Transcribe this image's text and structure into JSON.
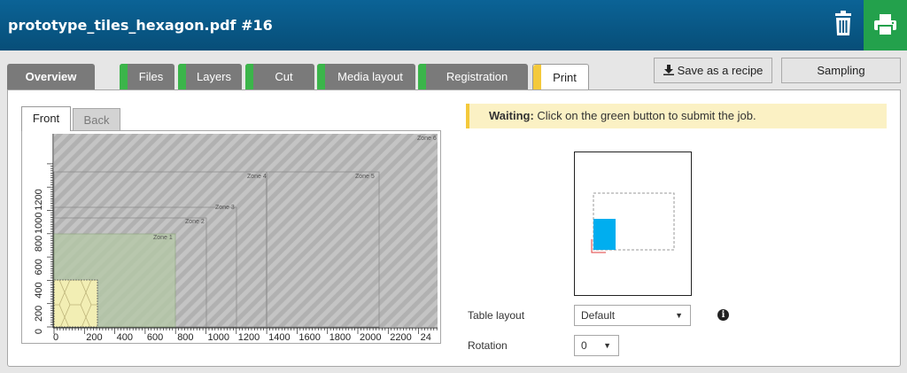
{
  "header": {
    "title": "prototype_tiles_hexagon.pdf #16"
  },
  "icons": {
    "delete": "trash-icon",
    "print": "printer-icon",
    "save": "download-icon",
    "info": "info-icon"
  },
  "colors": {
    "header": "#0b6396",
    "print_button": "#23a14c",
    "tab_done": "#3bb54a",
    "tab_current": "#f4c93b",
    "waiting_bg": "#fbf1c4",
    "print_object": "#00aeef"
  },
  "tabs": [
    {
      "label": "Overview"
    },
    {
      "label": "Files",
      "status": "done"
    },
    {
      "label": "Layers",
      "status": "done"
    },
    {
      "label": "Cut",
      "status": "done"
    },
    {
      "label": "Media layout",
      "status": "done"
    },
    {
      "label": "Registration",
      "status": "done"
    },
    {
      "label": "Print",
      "status": "current",
      "active": true
    }
  ],
  "toolbar": {
    "save_recipe": "Save as a recipe",
    "sampling": "Sampling"
  },
  "sides": {
    "front": "Front",
    "back": "Back",
    "active": "Front"
  },
  "table_plot": {
    "x_ticks": [
      "0",
      "200",
      "400",
      "600",
      "800",
      "1000",
      "1200",
      "1400",
      "1600",
      "1800",
      "2000",
      "2200",
      "24"
    ],
    "y_ticks": [
      "0",
      "200",
      "400",
      "600",
      "800",
      "1000",
      "1200"
    ],
    "zones": [
      "Zone 1",
      "Zone 2",
      "Zone 3",
      "Zone 4",
      "Zone 5",
      "Zone 6"
    ]
  },
  "status": {
    "label": "Waiting:",
    "message": "Click on the green button to submit the job."
  },
  "form": {
    "table_layout_label": "Table layout",
    "table_layout_value": "Default",
    "rotation_label": "Rotation",
    "rotation_value": "0"
  }
}
